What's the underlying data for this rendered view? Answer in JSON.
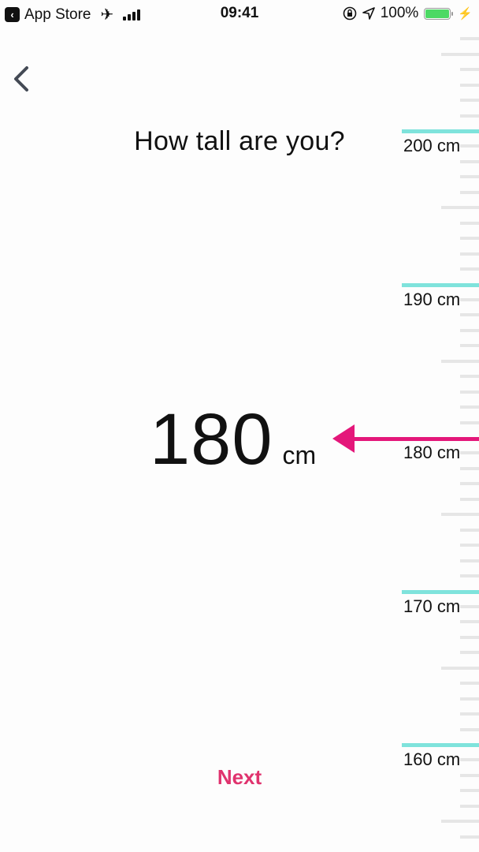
{
  "status_bar": {
    "back_app": "App Store",
    "time": "09:41",
    "battery": "100%",
    "icons": [
      "back-arrow-icon",
      "airplane-icon",
      "signal-icon",
      "orientation-lock-icon",
      "location-icon",
      "battery-icon",
      "charging-icon"
    ]
  },
  "nav": {
    "back_icon": "chevron-left-icon"
  },
  "question": "How tall are you?",
  "selection": {
    "value": "180",
    "unit": "cm"
  },
  "ruler": {
    "major_labels": [
      "200 cm",
      "190 cm",
      "180 cm",
      "170 cm",
      "160 cm"
    ],
    "major_values": [
      200,
      190,
      180,
      170,
      160
    ],
    "selected_value": 180,
    "accent_color": "#7fe3dc",
    "pointer_color": "#e4177a"
  },
  "next_label": "Next",
  "colors": {
    "next": "#e0336e"
  }
}
